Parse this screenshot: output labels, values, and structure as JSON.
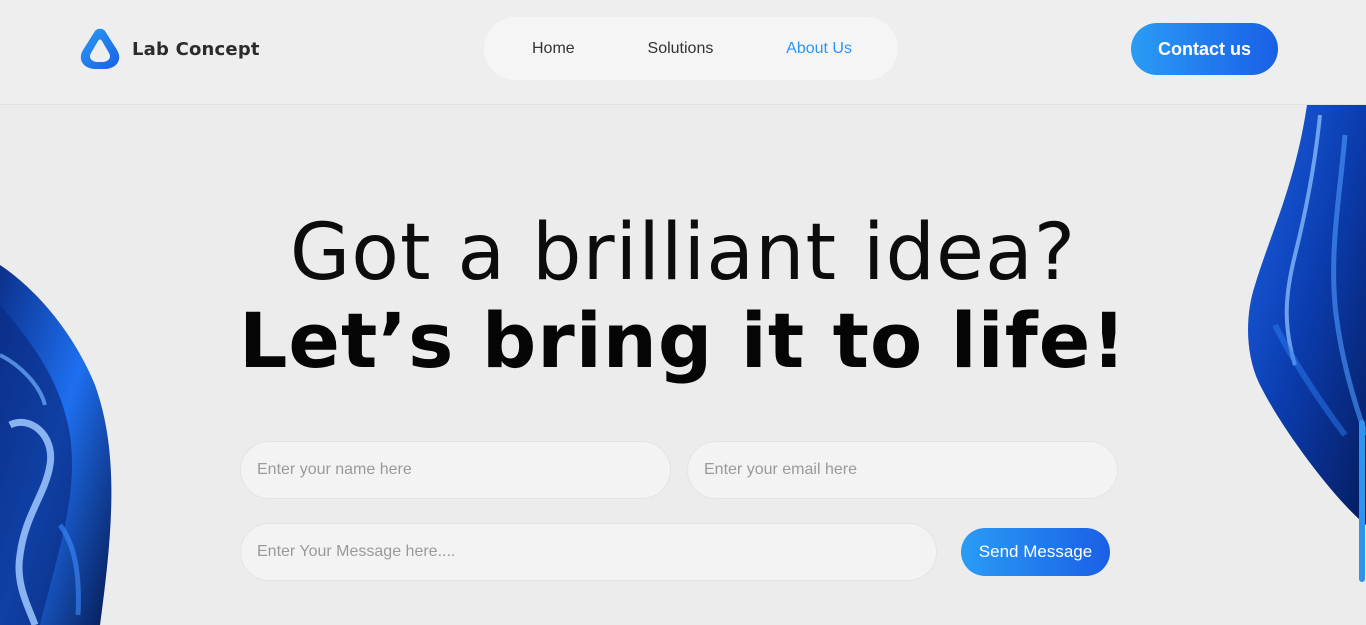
{
  "brand": {
    "name": "Lab Concept",
    "accent_color": "#2e96f0",
    "gradient": [
      "#2a9cf5",
      "#1a5fe6"
    ]
  },
  "nav": {
    "items": [
      {
        "label": "Home",
        "active": false
      },
      {
        "label": "Solutions",
        "active": false
      },
      {
        "label": "About Us",
        "active": true
      }
    ],
    "contact_label": "Contact us"
  },
  "hero": {
    "line1": "Got a brilliant idea?",
    "line2": "Let’s bring it to life!"
  },
  "form": {
    "name_placeholder": "Enter your name here",
    "email_placeholder": "Enter your email here",
    "message_placeholder": "Enter Your Message here....",
    "submit_label": "Send Message"
  },
  "icons": {
    "logo": "lab-concept-logo-icon"
  }
}
